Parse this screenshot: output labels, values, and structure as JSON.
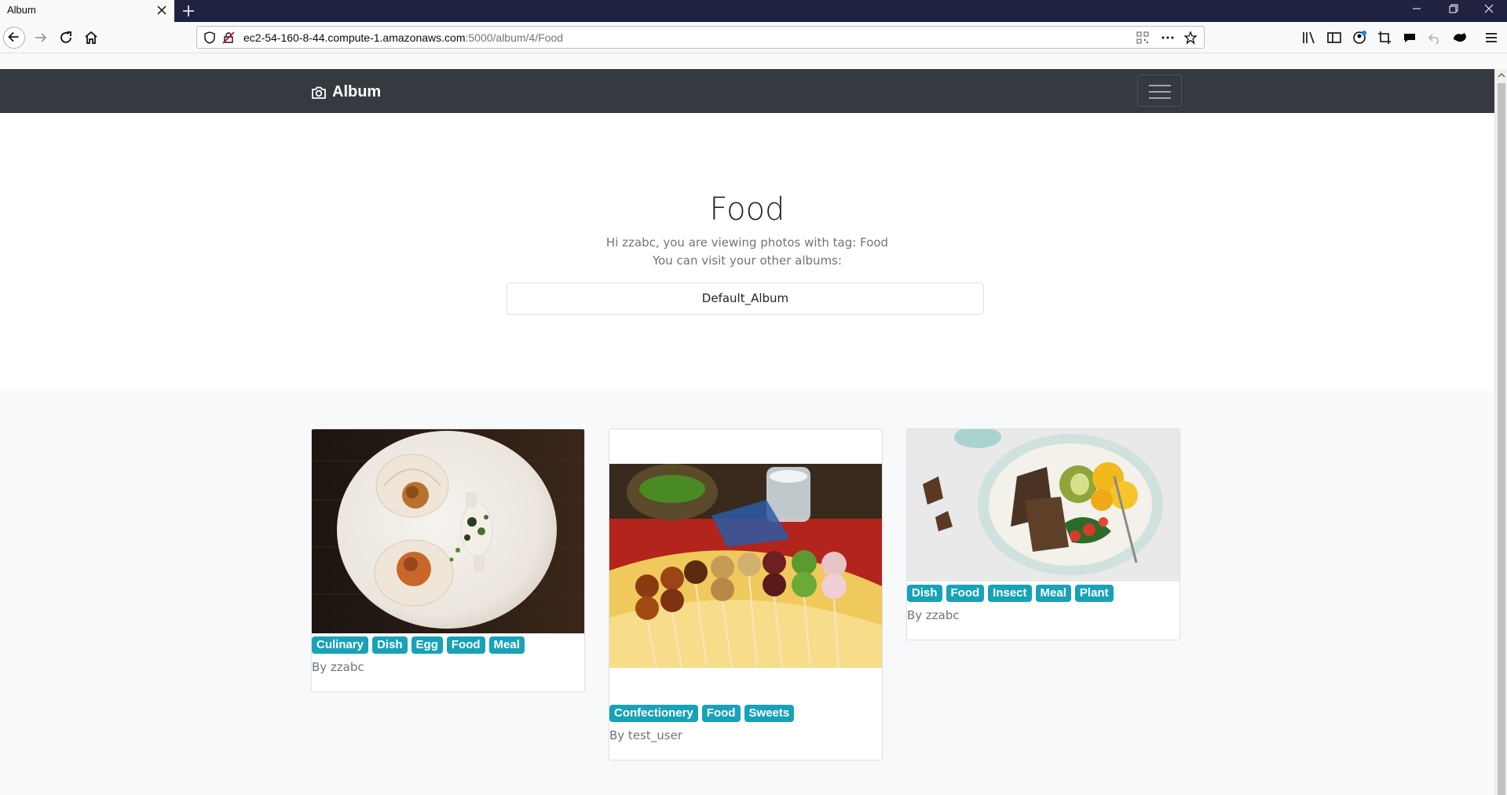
{
  "browser": {
    "tab_title": "Album",
    "url_host": "ec2-54-160-8-44.compute-1.amazonaws.com",
    "url_path": ":5000/album/4/Food"
  },
  "site": {
    "brand": "Album"
  },
  "hero": {
    "title": "Food",
    "greeting": "Hi zzabc, you are viewing photos with tag: Food",
    "other_albums_text": "You can visit your other albums:",
    "album_button": "Default_Album"
  },
  "cards": [
    {
      "tags": [
        "Culinary",
        "Dish",
        "Egg",
        "Food",
        "Meal"
      ],
      "byline": "By zzabc"
    },
    {
      "tags": [
        "Confectionery",
        "Food",
        "Sweets"
      ],
      "byline": "By test_user"
    },
    {
      "tags": [
        "Dish",
        "Food",
        "Insect",
        "Meal",
        "Plant"
      ],
      "byline": "By zzabc"
    }
  ],
  "colors": {
    "tag_bg": "#17a2b8",
    "header_bg": "#343a40",
    "tabstrip_bg": "#202340"
  },
  "icons": [
    "close-icon",
    "plus-icon",
    "back-arrow-icon",
    "forward-arrow-icon",
    "reload-icon",
    "home-icon",
    "shield-icon",
    "insecure-lock-icon",
    "qr-code-icon",
    "more-icon",
    "star-icon",
    "library-icon",
    "sidebar-icon",
    "account-icon",
    "crop-icon",
    "chat-icon",
    "undo-icon",
    "extension-icon",
    "menu-icon",
    "camera-icon"
  ]
}
